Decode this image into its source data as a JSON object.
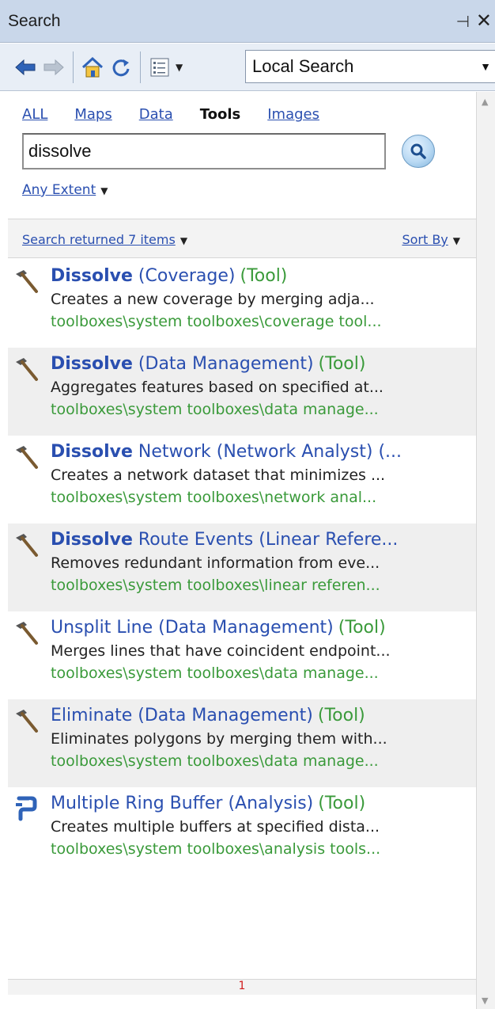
{
  "window": {
    "title": "Search"
  },
  "toolbar": {
    "scope_selected": "Local Search"
  },
  "tabs": [
    {
      "label": "ALL",
      "active": false
    },
    {
      "label": "Maps",
      "active": false
    },
    {
      "label": "Data",
      "active": false
    },
    {
      "label": "Tools",
      "active": true
    },
    {
      "label": "Images",
      "active": false
    }
  ],
  "search": {
    "query": "dissolve"
  },
  "extent": {
    "label": "Any Extent"
  },
  "results_bar": {
    "returned_label": "Search returned 7 items",
    "sort_label": "Sort By"
  },
  "results": [
    {
      "keyword": "Dissolve",
      "rest": " (Coverage)",
      "type": "(Tool)",
      "icon": "hammer-icon",
      "description": "Creates a new coverage by merging adja...",
      "path": "toolboxes\\system toolboxes\\coverage tool..."
    },
    {
      "keyword": "Dissolve",
      "rest": " (Data Management)",
      "type": "(Tool)",
      "icon": "hammer-icon",
      "description": "Aggregates features based on specified at...",
      "path": "toolboxes\\system toolboxes\\data manage..."
    },
    {
      "keyword": "Dissolve",
      "rest": " Network (Network Analyst) (...",
      "type": "",
      "icon": "hammer-icon",
      "description": "Creates a network dataset that minimizes ...",
      "path": "toolboxes\\system toolboxes\\network anal..."
    },
    {
      "keyword": "Dissolve",
      "rest": " Route Events (Linear Refere...",
      "type": "",
      "icon": "hammer-icon",
      "description": "Removes redundant information from eve...",
      "path": "toolboxes\\system toolboxes\\linear referen..."
    },
    {
      "keyword": "",
      "rest": "Unsplit Line (Data Management)",
      "type": "(Tool)",
      "icon": "hammer-icon",
      "description": "Merges lines that have coincident endpoint...",
      "path": "toolboxes\\system toolboxes\\data manage..."
    },
    {
      "keyword": "",
      "rest": "Eliminate (Data Management)",
      "type": "(Tool)",
      "icon": "hammer-icon",
      "description": "Eliminates polygons by merging them with...",
      "path": "toolboxes\\system toolboxes\\data manage..."
    },
    {
      "keyword": "",
      "rest": "Multiple Ring Buffer (Analysis)",
      "type": "(Tool)",
      "icon": "python-script-icon",
      "description": "Creates multiple buffers at specified dista...",
      "path": "toolboxes\\system toolboxes\\analysis tools..."
    }
  ],
  "pagination": {
    "current_page": "1"
  }
}
